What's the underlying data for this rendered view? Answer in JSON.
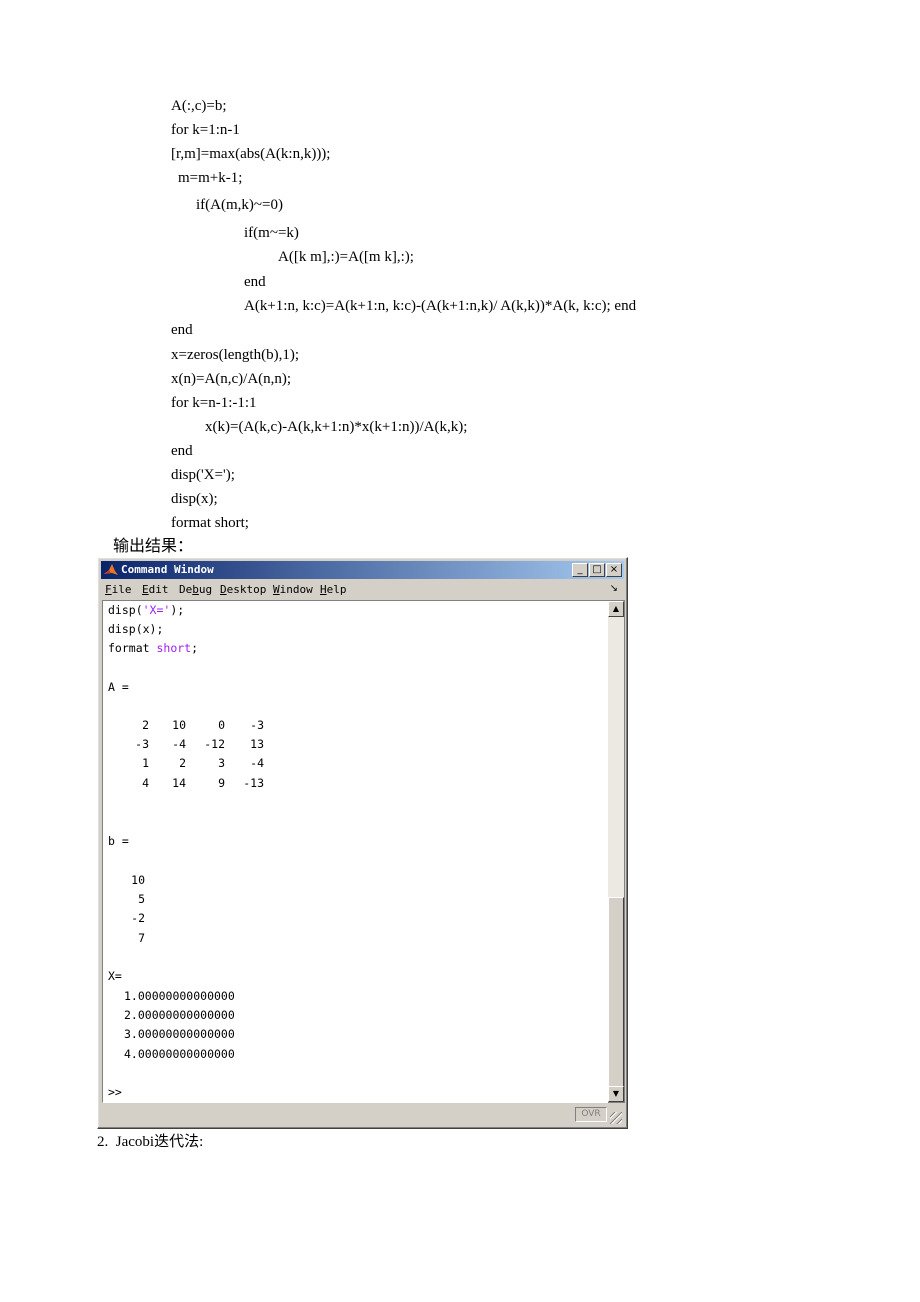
{
  "code_lines": [
    "A(:,c)=b;",
    "for k=1:n-1",
    "[r,m]=max(abs(A(k:n,k)));",
    "m=m+k-1;",
    "if(A(m,k)~=0)",
    "if(m~=k)",
    "A([k m],:)=A([m k],:);",
    "end",
    "A(k+1:n, k:c)=A(k+1:n, k:c)-(A(k+1:n,k)/ A(k,k))*A(k, k:c); end",
    "end",
    "x=zeros(length(b),1);",
    "x(n)=A(n,c)/A(n,n);",
    "for k=n-1:-1:1",
    "x(k)=(A(k,c)-A(k,k+1:n)*x(k+1:n))/A(k,k);",
    "end",
    "disp('X=');",
    "disp(x);",
    "format short;"
  ],
  "output_caption": "输出结果：",
  "window": {
    "title": "Command Window",
    "buttons": [
      "_",
      "□",
      "×"
    ],
    "menu": [
      {
        "hot": "F",
        "rest": "ile"
      },
      {
        "hot": "E",
        "rest": "dit"
      },
      {
        "pre": "De",
        "hot": "b",
        "rest": "ug"
      },
      {
        "hot": "D",
        "rest": "esktop"
      },
      {
        "hot": "W",
        "rest": "indow"
      },
      {
        "hot": "H",
        "rest": "elp"
      }
    ],
    "console": {
      "cmd1_func": "disp(",
      "cmd1_str": "'X='",
      "cmd1_end": ");",
      "cmd2": "disp(x);",
      "cmd3_kw": "format ",
      "cmd3_arg": "short",
      "cmd3_end": ";",
      "a_label": "A =",
      "a_rows": [
        [
          "2",
          "10",
          "0",
          "-3"
        ],
        [
          "-3",
          "-4",
          "-12",
          "13"
        ],
        [
          "1",
          "2",
          "3",
          "-4"
        ],
        [
          "4",
          "14",
          "9",
          "-13"
        ]
      ],
      "b_label": "b =",
      "b_values": [
        "10",
        "5",
        "-2",
        "7"
      ],
      "x_label": "X=",
      "x_values": [
        "1.00000000000000",
        "2.00000000000000",
        "3.00000000000000",
        "4.00000000000000"
      ],
      "prompt": ">>"
    },
    "status": "OVR"
  },
  "next_section": "2.  Jacobi迭代法:"
}
